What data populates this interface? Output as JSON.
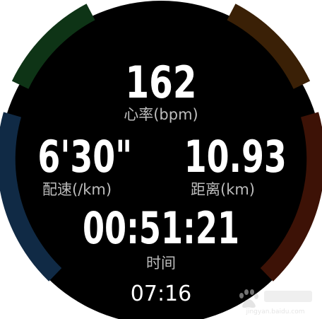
{
  "heart_rate": {
    "value": "162",
    "label": "心率(bpm)"
  },
  "pace": {
    "value": "6'30\"",
    "label": "配速(/km)"
  },
  "distance": {
    "value": "10.93",
    "label": "距离(km)"
  },
  "duration": {
    "value": "00:51:21",
    "label": "时间"
  },
  "clock": {
    "time": "07:16"
  },
  "watermark": {
    "text": "jingyan.baidu.com",
    "icon": "baidu-paw-logo"
  },
  "colors": {
    "face": "#000000",
    "ring_top_left": "#0e3416",
    "ring_top_right": "#3a2006",
    "ring_right": "#3d1206",
    "ring_left": "#102a45",
    "value_text": "#ffffff",
    "label_text": "#bdbdbd"
  }
}
